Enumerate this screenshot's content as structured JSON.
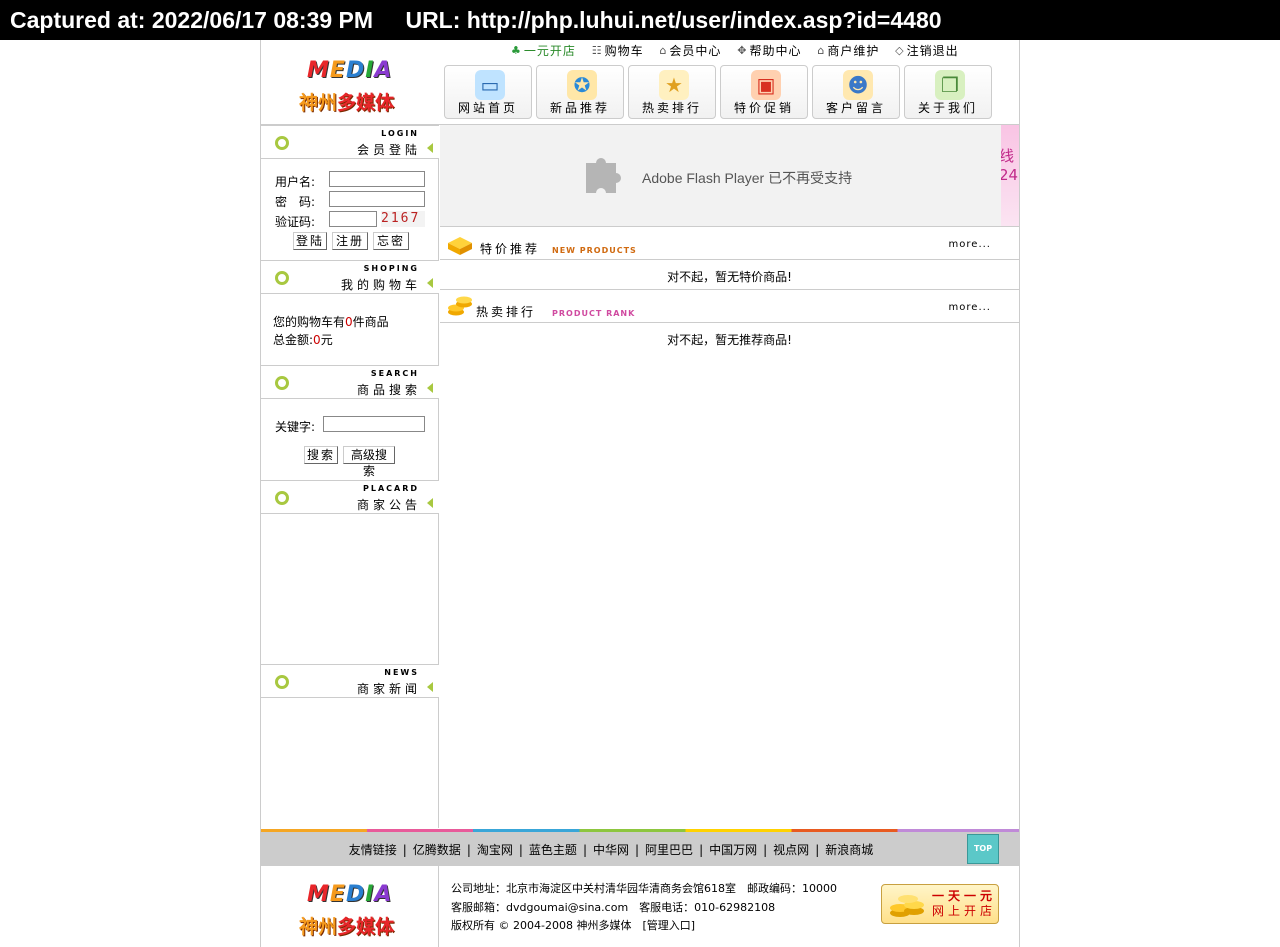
{
  "capture": {
    "captured_at": "Captured at: 2022/06/17 08:39 PM",
    "url": "URL: http://php.luhui.net/user/index.asp?id=4480"
  },
  "brand": {
    "logo_word": "MEDIA",
    "logo_cn": "神州多媒体",
    "colors": {
      "red": "#e8262a",
      "orange": "#f59a1d",
      "blue": "#2a7fd0",
      "green": "#28a838",
      "purple": "#8a3ad0"
    }
  },
  "top_links": [
    {
      "label": "一元开店",
      "icon": "store-icon"
    },
    {
      "label": "购物车",
      "icon": "cart-icon"
    },
    {
      "label": "会员中心",
      "icon": "home-icon"
    },
    {
      "label": "帮助中心",
      "icon": "help-icon"
    },
    {
      "label": "商户维护",
      "icon": "home-icon"
    },
    {
      "label": "注销退出",
      "icon": "logout-icon"
    }
  ],
  "nav": [
    {
      "label": "网站首页",
      "icon": "computer-icon"
    },
    {
      "label": "新品推荐",
      "icon": "award-gift-icon"
    },
    {
      "label": "热卖排行",
      "icon": "star-box-icon"
    },
    {
      "label": "特价促销",
      "icon": "gift-icon"
    },
    {
      "label": "客户留言",
      "icon": "users-icon"
    },
    {
      "label": "关于我们",
      "icon": "documents-icon"
    }
  ],
  "login": {
    "en": "LOGIN",
    "zh": "会员登陆",
    "username_label": "用户名:",
    "password_label": "密　码:",
    "captcha_label": "验证码:",
    "captcha_code": "2167",
    "login_btn": "登陆",
    "register_btn": "注册",
    "forgot_btn": "忘密"
  },
  "cart": {
    "en": "SHOPING",
    "zh": "我的购物车",
    "line1_prefix": "您的购物车有",
    "count": "0",
    "line1_suffix": "件商品",
    "line2_prefix": "总金额:",
    "amount": "0",
    "line2_suffix": "元"
  },
  "search": {
    "en": "SEARCH",
    "zh": "商品搜索",
    "keyword_label": "关键字:",
    "search_btn": "搜索",
    "advanced_btn": "高级搜索"
  },
  "placard": {
    "en": "PLACARD",
    "zh": "商家公告"
  },
  "news": {
    "en": "NEWS",
    "zh": "商家新闻"
  },
  "flash": {
    "message": "Adobe Flash Player 已不再受支持",
    "side_text": "线24"
  },
  "special": {
    "zh": "特价推荐",
    "en": "NEW PRODUCTS",
    "more": "more...",
    "empty": "对不起，暂无特价商品!"
  },
  "hot": {
    "zh": "热卖排行",
    "en": "PRODUCT RANK",
    "more": "more...",
    "empty": "对不起，暂无推荐商品!"
  },
  "footer": {
    "links": [
      "友情链接",
      "亿腾数据",
      "淘宝网",
      "蓝色主题",
      "中华网",
      "阿里巴巴",
      "中国万网",
      "视点网",
      "新浪商城"
    ],
    "top_btn": "TOP",
    "address": "公司地址：北京市海淀区中关村清华园华清商务会馆618室　邮政编码：10000",
    "contact": "客服邮箱：dvdgoumai@sina.com　客服电话：010-62982108",
    "copyright": "版权所有 © 2004-2008 神州多媒体　[管理入口]",
    "badge_line1": "一天一元",
    "badge_line2": "网上开店"
  }
}
